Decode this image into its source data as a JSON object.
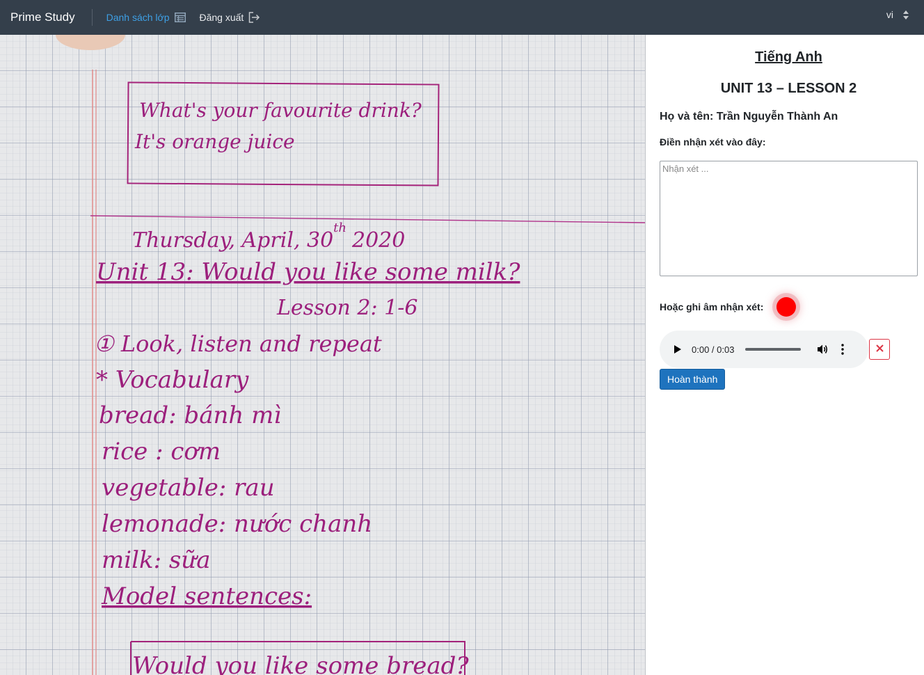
{
  "navbar": {
    "brand": "Prime Study",
    "class_list_label": "Danh sách lớp",
    "class_list_icon": "table-list-icon",
    "logout_label": "Đăng xuất",
    "logout_icon": "logout-icon",
    "language": "vi"
  },
  "notebook": {
    "box_line1": "What's your favourite drink?",
    "box_line2": "It's orange juice",
    "date": "Thursday, April, 30",
    "date_sup": "th",
    "date_year": "2020",
    "unit_title": "Unit 13: Would you like some milk?",
    "lesson": "Lesson 2: 1-6",
    "section1": "① Look, listen and repeat",
    "vocab_header": "* Vocabulary",
    "vocab": [
      "bread: bánh mì",
      "rice    : cơm",
      "vegetable: rau",
      "lemonade: nước chanh",
      "milk: sữa"
    ],
    "model": "Model sentences:",
    "bottom_box": "Would you like some bread?"
  },
  "panel": {
    "subject": "Tiếng Anh",
    "lesson": "UNIT 13 – LESSON 2",
    "student": "Họ và tên: Trần Nguyễn Thành An",
    "comment_label": "Điền nhận xét vào đây:",
    "comment_placeholder": "Nhận xét ...",
    "comment_value": "",
    "record_label": "Hoặc ghi âm nhận xét:",
    "audio_time": "0:00 / 0:03",
    "audio_progress": 0,
    "done_label": "Hoàn thành",
    "record_color": "#ff0000",
    "done_color": "#1e73be"
  }
}
